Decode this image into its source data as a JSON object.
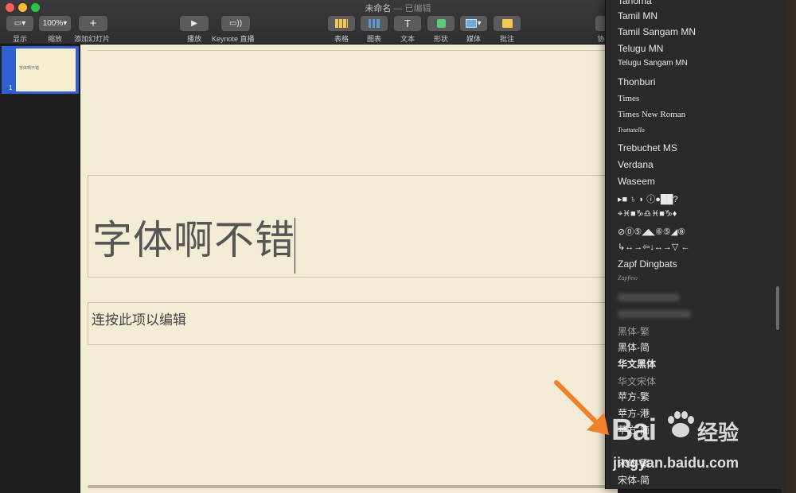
{
  "window": {
    "title": "未命名",
    "subtitle": "— 已编辑"
  },
  "toolbar": {
    "view": {
      "label": "显示"
    },
    "zoom": {
      "value": "100%",
      "label": "缩放"
    },
    "add_slide": {
      "label": "添加幻灯片"
    },
    "play": {
      "label": "播放"
    },
    "keynote_live": {
      "label": "Keynote 直播"
    },
    "table": {
      "label": "表格"
    },
    "chart": {
      "label": "图表"
    },
    "text": {
      "label": "文本"
    },
    "shape": {
      "label": "形状"
    },
    "media": {
      "label": "媒体"
    },
    "comment": {
      "label": "批注"
    },
    "partial_right": "协"
  },
  "sidebar": {
    "slides": [
      {
        "number": "1",
        "thumb_text": "字体啊不错"
      }
    ]
  },
  "slide": {
    "title": "字体啊不错",
    "body_placeholder": "连按此项以编辑"
  },
  "font_menu": {
    "items": [
      {
        "label": "Tahoma",
        "style": "partial"
      },
      {
        "label": "Tamil MN"
      },
      {
        "label": "Tamil Sangam MN"
      },
      {
        "label": "Telugu MN"
      },
      {
        "label": "Telugu Sangam MN"
      },
      {
        "label": "Thonburi"
      },
      {
        "label": "Times"
      },
      {
        "label": "Times New Roman"
      },
      {
        "label": "Trattatello"
      },
      {
        "label": "Trebuchet MS"
      },
      {
        "label": "Verdana"
      },
      {
        "label": "Waseem"
      },
      {
        "label": "▸■ ♄ ◗ ⓘ●██?",
        "style": "symbol"
      },
      {
        "label": "⌖♓■♑♎♓■♑♦",
        "style": "symbol"
      },
      {
        "label": "⊘⓪⑤◢◣⑥⑤◢⑧",
        "style": "symbol"
      },
      {
        "label": "↳↔→⇦↓↔→▽  ←",
        "style": "symbol"
      },
      {
        "label": "Zapf Dingbats"
      },
      {
        "label": "Zapfino"
      },
      {
        "label": "黑体-繁"
      },
      {
        "label": "黑体-简"
      },
      {
        "label": "华文黑体"
      },
      {
        "label": "华文宋体"
      },
      {
        "label": "苹方-繁"
      },
      {
        "label": "苹方-港"
      },
      {
        "label": "苹方-简"
      },
      {
        "label": "宋体-繁"
      },
      {
        "label": "宋体-简"
      }
    ]
  },
  "watermark": {
    "brand": "Bai",
    "brand_cn": "经验",
    "url": "jingyan.baidu.com"
  },
  "colors": {
    "accent_arrow": "#f0802a",
    "selection": "#2f5fd0",
    "canvas": "#f3ecd5"
  }
}
